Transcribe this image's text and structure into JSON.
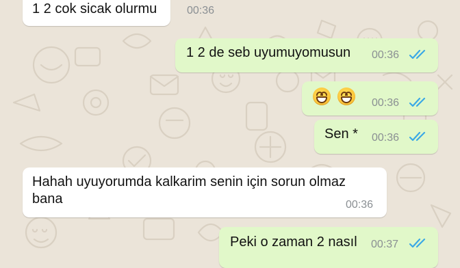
{
  "colors": {
    "chat_background": "#ebe4d9",
    "incoming_bubble": "#ffffff",
    "outgoing_bubble": "#e1f8c9",
    "read_ticks": "#3aa8e6",
    "timestamp": "#8a8f93"
  },
  "messages": [
    {
      "direction": "incoming",
      "text": "1 2 cok sicak olurmu",
      "time": "00:36"
    },
    {
      "direction": "outgoing",
      "text": "1 2 de seb uyumuyomusun",
      "time": "00:36",
      "status": "read"
    },
    {
      "direction": "outgoing",
      "text": "😄😄",
      "emoji": "grinning-face-icon",
      "emoji_count": 2,
      "time": "00:36",
      "status": "read"
    },
    {
      "direction": "outgoing",
      "text": "Sen *",
      "time": "00:36",
      "status": "read"
    },
    {
      "direction": "incoming",
      "text": "Hahah uyuyorumda kalkarim senin için sorun olmaz bana",
      "time": "00:36"
    },
    {
      "direction": "outgoing",
      "text": "Peki o zaman 2 nasıl",
      "time": "00:37",
      "status": "read"
    }
  ]
}
